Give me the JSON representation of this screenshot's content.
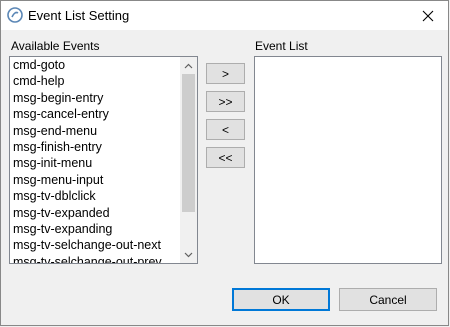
{
  "window": {
    "title": "Event List Setting",
    "close_glyph": "✕"
  },
  "available": {
    "label": "Available Events",
    "items": [
      "cmd-goto",
      "cmd-help",
      "msg-begin-entry",
      "msg-cancel-entry",
      "msg-end-menu",
      "msg-finish-entry",
      "msg-init-menu",
      "msg-menu-input",
      "msg-tv-dblclick",
      "msg-tv-expanded",
      "msg-tv-expanding",
      "msg-tv-selchange-out-next",
      "msg-tv-selchange-out-prev"
    ]
  },
  "event_list": {
    "label": "Event List",
    "items": []
  },
  "transfer": {
    "add": ">",
    "add_all": ">>",
    "remove": "<",
    "remove_all": "<<"
  },
  "footer": {
    "ok": "OK",
    "cancel": "Cancel"
  },
  "colors": {
    "accent": "#0078d7"
  }
}
